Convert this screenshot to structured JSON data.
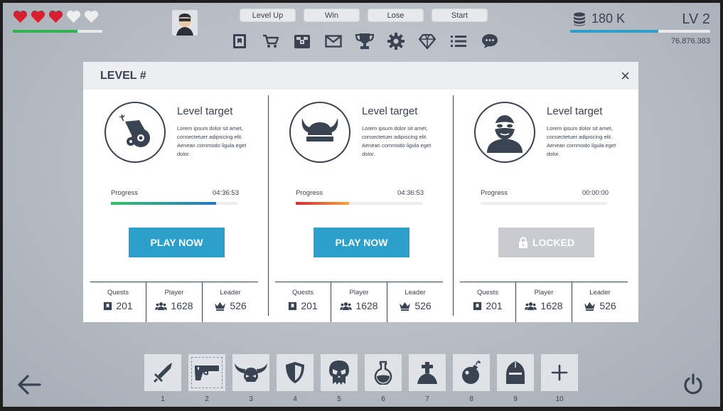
{
  "hud": {
    "hearts": {
      "total": 5,
      "filled": 3,
      "filled_color": "#d6202f",
      "empty_color": "#eceef0"
    },
    "health_fraction": 0.72,
    "debug_buttons": [
      "Level Up",
      "Win",
      "Lose",
      "Start"
    ],
    "menu_icons": [
      "quest-book-icon",
      "shop-cart-icon",
      "chest-icon",
      "mail-icon",
      "trophy-icon",
      "settings-gear-icon",
      "gem-icon",
      "list-icon",
      "chat-icon"
    ],
    "coins": "180 K",
    "level": "LV 2",
    "xp_fraction": 0.63,
    "xp_value": "76.876.383"
  },
  "modal": {
    "title": "LEVEL #",
    "close_label": "×",
    "levels": [
      {
        "emblem": "cannon-icon",
        "title": "Level target",
        "description": "Lorem ipsum dolor sit amet, consectetuer adipiscing elit. Aenean commodo ligula eget dolor.",
        "progress_label": "Progress",
        "time": "04:36:53",
        "progress_fraction": 0.83,
        "progress_colors": [
          "#35c06a",
          "#2a78c4"
        ],
        "button": "PLAY NOW",
        "locked": false,
        "stats": [
          {
            "label": "Quests",
            "value": "201",
            "icon": "quest-book-icon"
          },
          {
            "label": "Player",
            "value": "1628",
            "icon": "players-icon"
          },
          {
            "label": "Leader",
            "value": "526",
            "icon": "crown-icon"
          }
        ]
      },
      {
        "emblem": "viking-helmet-icon",
        "title": "Level target",
        "description": "Lorem ipsum dolor sit amet, consectetuer adipiscing elit. Aenean commodo ligula eget dolor.",
        "progress_label": "Progress",
        "time": "04:36:53",
        "progress_fraction": 0.42,
        "progress_colors": [
          "#d52b3a",
          "#f2a43a"
        ],
        "button": "PLAY NOW",
        "locked": false,
        "stats": [
          {
            "label": "Quests",
            "value": "201",
            "icon": "quest-book-icon"
          },
          {
            "label": "Player",
            "value": "1628",
            "icon": "players-icon"
          },
          {
            "label": "Leader",
            "value": "526",
            "icon": "crown-icon"
          }
        ]
      },
      {
        "emblem": "masked-thief-icon",
        "title": "Level target",
        "description": "Lorem ipsum dolor sit amet, consectetuer adipiscing elit. Aenean commodo ligula eget dolor.",
        "progress_label": "Progress",
        "time": "00:00:00",
        "progress_fraction": 0,
        "progress_colors": [
          "#eceef0",
          "#eceef0"
        ],
        "button": "LOCKED",
        "locked": true,
        "stats": [
          {
            "label": "Quests",
            "value": "201",
            "icon": "quest-book-icon"
          },
          {
            "label": "Player",
            "value": "1628",
            "icon": "players-icon"
          },
          {
            "label": "Leader",
            "value": "526",
            "icon": "crown-icon"
          }
        ]
      }
    ]
  },
  "inventory": {
    "selected_index": 1,
    "slots": [
      {
        "num": "1",
        "icon": "sword-icon"
      },
      {
        "num": "2",
        "icon": "pistol-icon"
      },
      {
        "num": "3",
        "icon": "horned-helmet-icon"
      },
      {
        "num": "4",
        "icon": "shield-icon"
      },
      {
        "num": "5",
        "icon": "skull-icon"
      },
      {
        "num": "6",
        "icon": "potion-icon"
      },
      {
        "num": "7",
        "icon": "grave-icon"
      },
      {
        "num": "8",
        "icon": "bomb-icon"
      },
      {
        "num": "9",
        "icon": "knight-helmet-icon"
      },
      {
        "num": "10",
        "icon": "plus-icon"
      }
    ]
  },
  "colors": {
    "ink": "#3a4352",
    "accent": "#2c9fcb"
  }
}
